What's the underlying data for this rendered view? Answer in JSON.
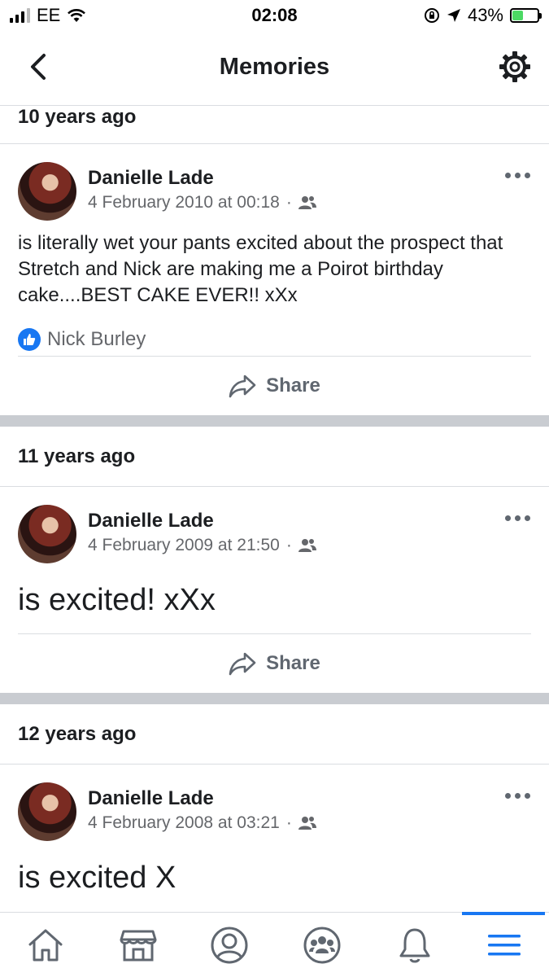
{
  "status_bar": {
    "carrier": "EE",
    "time": "02:08",
    "battery_percent": "43%"
  },
  "nav": {
    "title": "Memories"
  },
  "sections": [
    {
      "header": "10 years ago",
      "post": {
        "author": "Danielle Lade",
        "timestamp": "4 February 2010 at 00:18",
        "separator": "·",
        "text": "is literally wet your pants excited about the prospect that Stretch and Nick are making me a Poirot birthday cake....BEST CAKE EVER!! xXx",
        "likes": "Nick Burley",
        "share_label": "Share"
      }
    },
    {
      "header": "11 years ago",
      "post": {
        "author": "Danielle Lade",
        "timestamp": "4 February 2009 at 21:50",
        "separator": "·",
        "text": "is excited! xXx",
        "share_label": "Share"
      }
    },
    {
      "header": "12 years ago",
      "post": {
        "author": "Danielle Lade",
        "timestamp": "4 February 2008 at 03:21",
        "separator": "·",
        "text": "is excited X"
      }
    }
  ],
  "tabs": [
    "home-icon",
    "marketplace-icon",
    "profile-icon",
    "groups-icon",
    "notifications-icon",
    "menu-icon"
  ],
  "colors": {
    "accent": "#1877f2",
    "battery": "#4cd964",
    "secondary_text": "#65676b",
    "separator_band": "#c9ccd1"
  }
}
